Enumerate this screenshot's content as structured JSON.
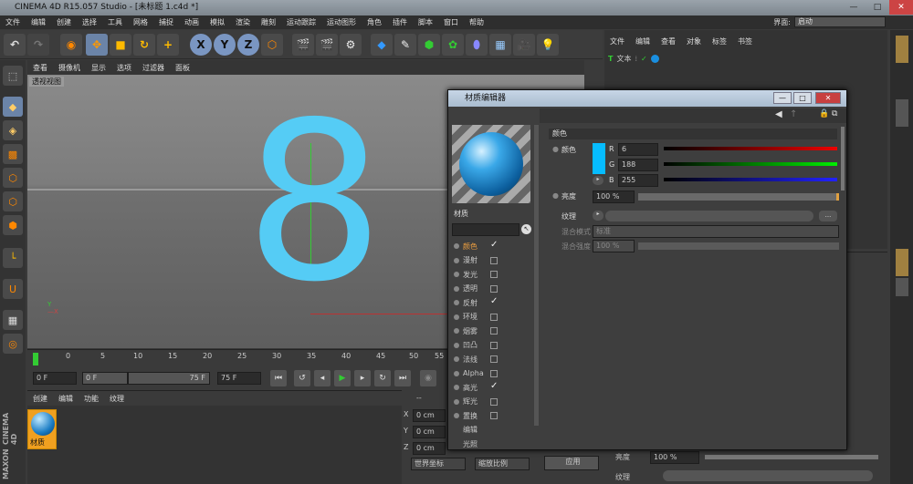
{
  "title": "CINEMA 4D R15.057 Studio - [未标题 1.c4d *]",
  "menu": [
    "文件",
    "编辑",
    "创建",
    "选择",
    "工具",
    "网格",
    "捕捉",
    "动画",
    "模拟",
    "渲染",
    "雕刻",
    "运动跟踪",
    "运动图形",
    "角色",
    "插件",
    "脚本",
    "窗口",
    "帮助"
  ],
  "layout": {
    "label": "界面:",
    "value": "启动"
  },
  "viewport": {
    "menu": [
      "查看",
      "摄像机",
      "显示",
      "选项",
      "过滤器",
      "面板"
    ],
    "label": "透视视图",
    "text": "8"
  },
  "timeline": {
    "ticks": [
      "0",
      "5",
      "10",
      "15",
      "20",
      "25",
      "30",
      "35",
      "40",
      "45",
      "50",
      "55"
    ],
    "start": "0 F",
    "range_start": "0 F",
    "range_end": "75 F",
    "end": "75 F"
  },
  "material_manager": {
    "menu": [
      "创建",
      "编辑",
      "功能",
      "纹理"
    ],
    "material_name": "材质"
  },
  "coords": {
    "x": "0 cm",
    "y": "0 cm",
    "z": "0 cm",
    "dots": "--",
    "world": "世界坐标",
    "scale": "缩放比例",
    "apply": "应用"
  },
  "object_manager": {
    "menu": [
      "文件",
      "编辑",
      "查看",
      "对象",
      "标签",
      "书签"
    ],
    "object": "文本"
  },
  "attr": {
    "brightness_label": "亮度",
    "brightness": "100 %",
    "texture_label": "纹理"
  },
  "dialog": {
    "title": "材质编辑器",
    "material_name": "材质",
    "channels": [
      {
        "label": "颜色",
        "checked": true,
        "active": true
      },
      {
        "label": "漫射",
        "checked": false
      },
      {
        "label": "发光",
        "checked": false
      },
      {
        "label": "透明",
        "checked": false
      },
      {
        "label": "反射",
        "checked": true
      },
      {
        "label": "环境",
        "checked": false
      },
      {
        "label": "烟雾",
        "checked": false
      },
      {
        "label": "凹凸",
        "checked": false
      },
      {
        "label": "法线",
        "checked": false
      },
      {
        "label": "Alpha",
        "checked": false
      },
      {
        "label": "高光",
        "checked": true
      },
      {
        "label": "辉光",
        "checked": false
      },
      {
        "label": "置换",
        "checked": false
      },
      {
        "label": "编辑",
        "checked": null
      },
      {
        "label": "光照",
        "checked": null
      }
    ],
    "section": "颜色",
    "color_label": "颜色",
    "r": "6",
    "g": "188",
    "b": "255",
    "brightness_label": "亮度",
    "brightness": "100 %",
    "texture_label": "纹理",
    "mix_mode_label": "混合模式",
    "mix_mode": "标准",
    "mix_strength_label": "混合强度",
    "mix_strength": "100 %",
    "swatch_color": "#06BCFF"
  },
  "brand": {
    "maxon": "MAXON",
    "c4d": "CINEMA 4D"
  }
}
